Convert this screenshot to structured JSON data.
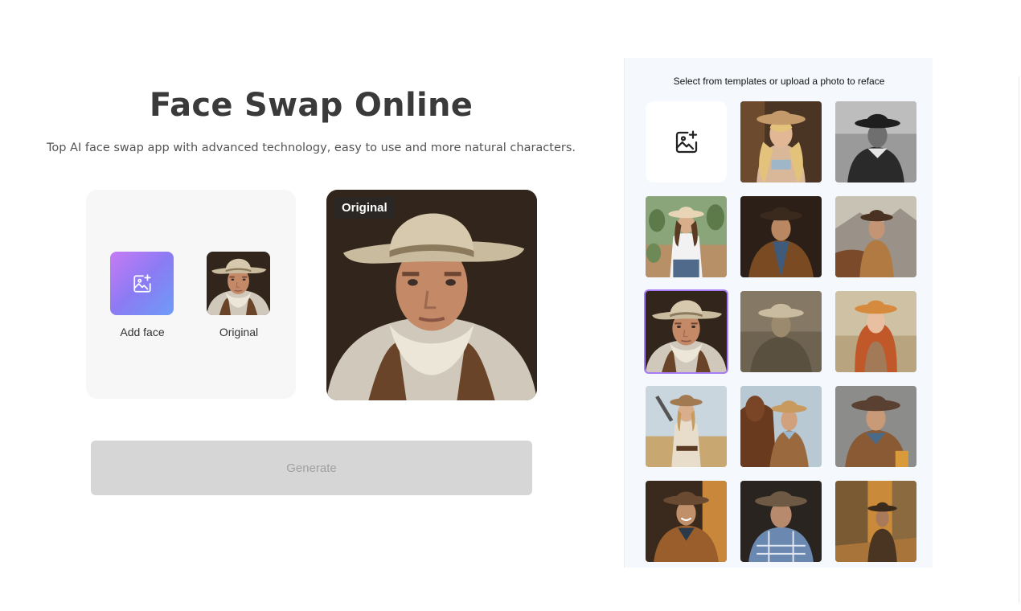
{
  "header": {
    "title": "Face Swap Online",
    "subtitle": "Top AI face swap app with advanced technology, easy to use and more natural characters."
  },
  "face_panel": {
    "add_face_label": "Add face",
    "original_label": "Original"
  },
  "preview": {
    "badge": "Original"
  },
  "actions": {
    "generate_label": "Generate"
  },
  "templates": {
    "heading": "Select from templates or upload a photo to reface",
    "selected_index": 6,
    "items": [
      {
        "icon": "upload-image-icon"
      },
      {
        "icon": "cowgirl-blonde-portrait"
      },
      {
        "icon": "cowboy-bw-portrait"
      },
      {
        "icon": "cowgirl-cactus-portrait"
      },
      {
        "icon": "cowboy-jacket-portrait"
      },
      {
        "icon": "cowboy-horse-portrait"
      },
      {
        "icon": "cowboy-original-portrait"
      },
      {
        "icon": "cowboy-sepia-portrait"
      },
      {
        "icon": "cowgirl-redhead-portrait"
      },
      {
        "icon": "cowgirl-pistol-portrait"
      },
      {
        "icon": "cowboy-with-horse-portrait"
      },
      {
        "icon": "young-cowboy-portrait"
      },
      {
        "icon": "smiling-cowboy-portrait"
      },
      {
        "icon": "elderly-cowboy-portrait"
      },
      {
        "icon": "cowboy-town-portrait"
      }
    ]
  },
  "colors": {
    "accent_gradient_start": "#c77bf5",
    "accent_gradient_end": "#6e9cf8",
    "selected_border": "#a97cf7",
    "generate_disabled_bg": "#d6d6d6"
  }
}
